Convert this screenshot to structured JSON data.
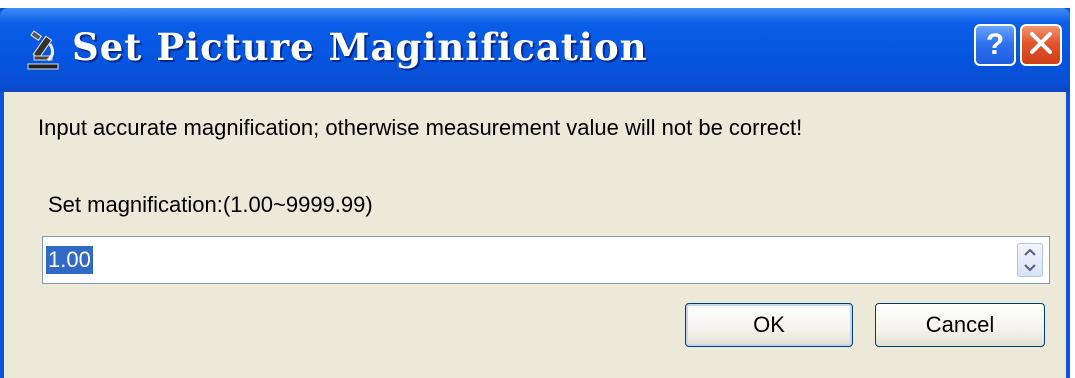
{
  "window": {
    "title": "Set Picture Maginification",
    "app_icon": "microscope-icon",
    "help_label": "?",
    "close_icon": "close-icon"
  },
  "dialog": {
    "warning_text": "Input accurate magnification; otherwise measurement value will not be correct!",
    "range_label": "Set magnification:(1.00~9999.99)",
    "magnification_value": "1.00",
    "ok_label": "OK",
    "cancel_label": "Cancel"
  },
  "colors": {
    "titlebar": "#0554e0",
    "client_bg": "#ece9d8",
    "close_button": "#e2552b",
    "selection": "#316ac5"
  }
}
